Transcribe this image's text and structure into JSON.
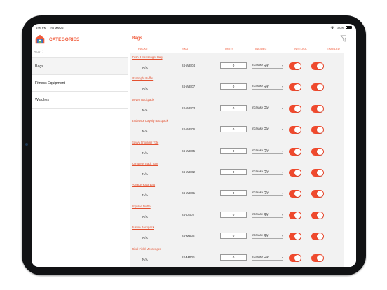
{
  "statusbar": {
    "time": "6:09 PM",
    "date": "Thu Mar 26",
    "battery": "100%"
  },
  "sidebar": {
    "title": "CATEGORIES",
    "breadcrumb": "Gear",
    "items": [
      {
        "label": "Bags",
        "active": true
      },
      {
        "label": "Fitness Equipment",
        "active": false
      },
      {
        "label": "Watches",
        "active": false
      }
    ]
  },
  "main": {
    "title": "Bags",
    "columns": {
      "rack": "RACK#",
      "sku": "SKU",
      "units": "UNITS",
      "incdec": "INC/DEC",
      "instock": "IN STOCK",
      "enabled": "ENABLED"
    },
    "rows": [
      {
        "name": "Push It Messenger Bag",
        "rack": "N/A",
        "sku": "24-WB04",
        "units": "0",
        "incdec": "Increase Qty"
      },
      {
        "name": "Overnight Duffle",
        "rack": "N/A",
        "sku": "24-WB07",
        "units": "0",
        "incdec": "Increase Qty"
      },
      {
        "name": "Driven Backpack",
        "rack": "N/A",
        "sku": "24-WB03",
        "units": "0",
        "incdec": "Increase Qty"
      },
      {
        "name": "Endeavor Daytrip Backpack",
        "rack": "N/A",
        "sku": "24-WB06",
        "units": "0",
        "incdec": "Increase Qty"
      },
      {
        "name": "Savvy Shoulder Tote",
        "rack": "N/A",
        "sku": "24-WB05",
        "units": "0",
        "incdec": "Increase Qty"
      },
      {
        "name": "Compete Track Tote",
        "rack": "N/A",
        "sku": "24-WB02",
        "units": "0",
        "incdec": "Increase Qty"
      },
      {
        "name": "Voyage Yoga Bag",
        "rack": "N/A",
        "sku": "24-WB01",
        "units": "0",
        "incdec": "Increase Qty"
      },
      {
        "name": "Impulse Duffle",
        "rack": "N/A",
        "sku": "24-UB02",
        "units": "0",
        "incdec": "Increase Qty"
      },
      {
        "name": "Fusion Backpack",
        "rack": "N/A",
        "sku": "24-MB02",
        "units": "0",
        "incdec": "Increase Qty"
      },
      {
        "name": "Rival Field Messenger",
        "rack": "N/A",
        "sku": "24-MB06",
        "units": "0",
        "incdec": "Increase Qty"
      }
    ]
  },
  "colors": {
    "accent": "#f05a3a",
    "toggle_on": "#ef4a2e"
  }
}
